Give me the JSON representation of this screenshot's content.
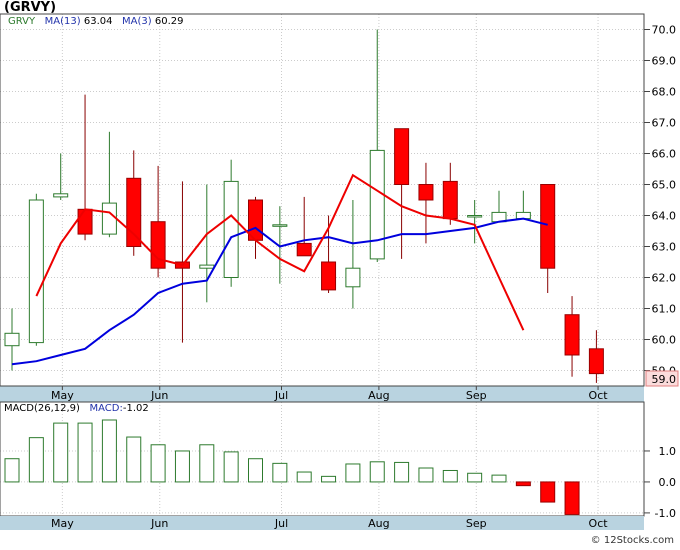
{
  "symbol": "(GRVY)",
  "legend_main": {
    "ticker": "GRVY",
    "ma13_label": "MA(13)",
    "ma13_value": "63.04",
    "ma3_label": "MA(3)",
    "ma3_value": "60.29"
  },
  "legend_macd": {
    "macd_label": "MACD(26,12,9)",
    "macd_value_label": "MACD:",
    "macd_value": "-1.02"
  },
  "price_tag": "59.0",
  "watermark": "© 12Stocks.com",
  "colors": {
    "up_candle": "#2d7a2d",
    "down_candle": "#ff0000",
    "ma13": "#0000dd",
    "ma3": "#ee0000",
    "axis_band": "#b9d3e0",
    "macd_bar_pos": "#2d7a2d",
    "macd_bar_neg": "#ff0000"
  },
  "chart_data": [
    {
      "type": "candlestick",
      "title": "(GRVY)",
      "x_labels": [
        "May",
        "Jun",
        "Jul",
        "Aug",
        "Sep",
        "Oct"
      ],
      "x_label_index": [
        1,
        5,
        10,
        14,
        18,
        23
      ],
      "ylim": [
        58.5,
        70.5
      ],
      "yticks": [
        59.0,
        60.0,
        61.0,
        62.0,
        63.0,
        64.0,
        65.0,
        66.0,
        67.0,
        68.0,
        69.0,
        70.0
      ],
      "candles": [
        {
          "o": 59.8,
          "c": 60.2,
          "h": 61.0,
          "l": 59.0
        },
        {
          "o": 59.9,
          "c": 64.5,
          "h": 64.7,
          "l": 59.8
        },
        {
          "o": 64.6,
          "c": 64.7,
          "h": 66.0,
          "l": 64.5
        },
        {
          "o": 64.2,
          "c": 63.4,
          "h": 67.9,
          "l": 63.2
        },
        {
          "o": 63.4,
          "c": 64.4,
          "h": 66.7,
          "l": 63.3
        },
        {
          "o": 65.2,
          "c": 63.0,
          "h": 66.1,
          "l": 62.7
        },
        {
          "o": 63.8,
          "c": 62.3,
          "h": 65.6,
          "l": 62.0
        },
        {
          "o": 62.5,
          "c": 62.3,
          "h": 65.1,
          "l": 59.9
        },
        {
          "o": 62.3,
          "c": 62.4,
          "h": 65.0,
          "l": 61.2
        },
        {
          "o": 62.0,
          "c": 65.1,
          "h": 65.8,
          "l": 61.7
        },
        {
          "o": 64.5,
          "c": 63.2,
          "h": 64.6,
          "l": 62.6
        },
        {
          "o": 63.7,
          "c": 63.7,
          "h": 64.3,
          "l": 61.8
        },
        {
          "o": 63.1,
          "c": 62.7,
          "h": 64.6,
          "l": 62.7
        },
        {
          "o": 62.5,
          "c": 61.6,
          "h": 64.0,
          "l": 61.5
        },
        {
          "o": 61.7,
          "c": 62.3,
          "h": 64.5,
          "l": 61.0
        },
        {
          "o": 62.6,
          "c": 66.1,
          "h": 70.0,
          "l": 62.5
        },
        {
          "o": 66.8,
          "c": 65.0,
          "h": 66.8,
          "l": 62.6
        },
        {
          "o": 65.0,
          "c": 64.5,
          "h": 65.7,
          "l": 63.1
        },
        {
          "o": 65.1,
          "c": 63.9,
          "h": 65.7,
          "l": 63.7
        },
        {
          "o": 64.0,
          "c": 64.0,
          "h": 64.5,
          "l": 63.1
        },
        {
          "o": 63.8,
          "c": 64.1,
          "h": 64.8,
          "l": 63.8
        },
        {
          "o": 63.9,
          "c": 64.1,
          "h": 64.8,
          "l": 63.9
        },
        {
          "o": 65.0,
          "c": 62.3,
          "h": 65.0,
          "l": 61.5
        },
        {
          "o": 60.8,
          "c": 59.5,
          "h": 61.4,
          "l": 58.8
        },
        {
          "o": 59.7,
          "c": 58.9,
          "h": 60.3,
          "l": 58.6
        }
      ],
      "ma13": [
        59.2,
        59.3,
        59.5,
        59.7,
        60.3,
        60.8,
        61.5,
        61.8,
        61.9,
        63.3,
        63.6,
        63.0,
        63.2,
        63.3,
        63.1,
        63.2,
        63.4,
        63.4,
        63.5,
        63.6,
        63.8,
        63.9,
        63.7
      ],
      "ma13_start": 0,
      "ma3": [
        61.4,
        63.1,
        64.2,
        64.1,
        63.4,
        62.6,
        62.4,
        63.4,
        64.0,
        63.2,
        62.6,
        62.2,
        63.6,
        65.3,
        64.8,
        64.3,
        64.0,
        63.9,
        63.7,
        62.0,
        60.3
      ],
      "ma3_start": 1
    },
    {
      "type": "bar",
      "title": "MACD(26,12,9)",
      "ylim": [
        -1.1,
        2.0
      ],
      "yticks": [
        1.0,
        0.0,
        -1.0
      ],
      "values": [
        0.75,
        1.43,
        1.9,
        1.9,
        2.0,
        1.45,
        1.2,
        1.0,
        1.2,
        0.97,
        0.75,
        0.6,
        0.32,
        0.18,
        0.58,
        0.65,
        0.63,
        0.45,
        0.37,
        0.28,
        0.22,
        -0.12,
        -0.65,
        -1.05
      ]
    }
  ]
}
